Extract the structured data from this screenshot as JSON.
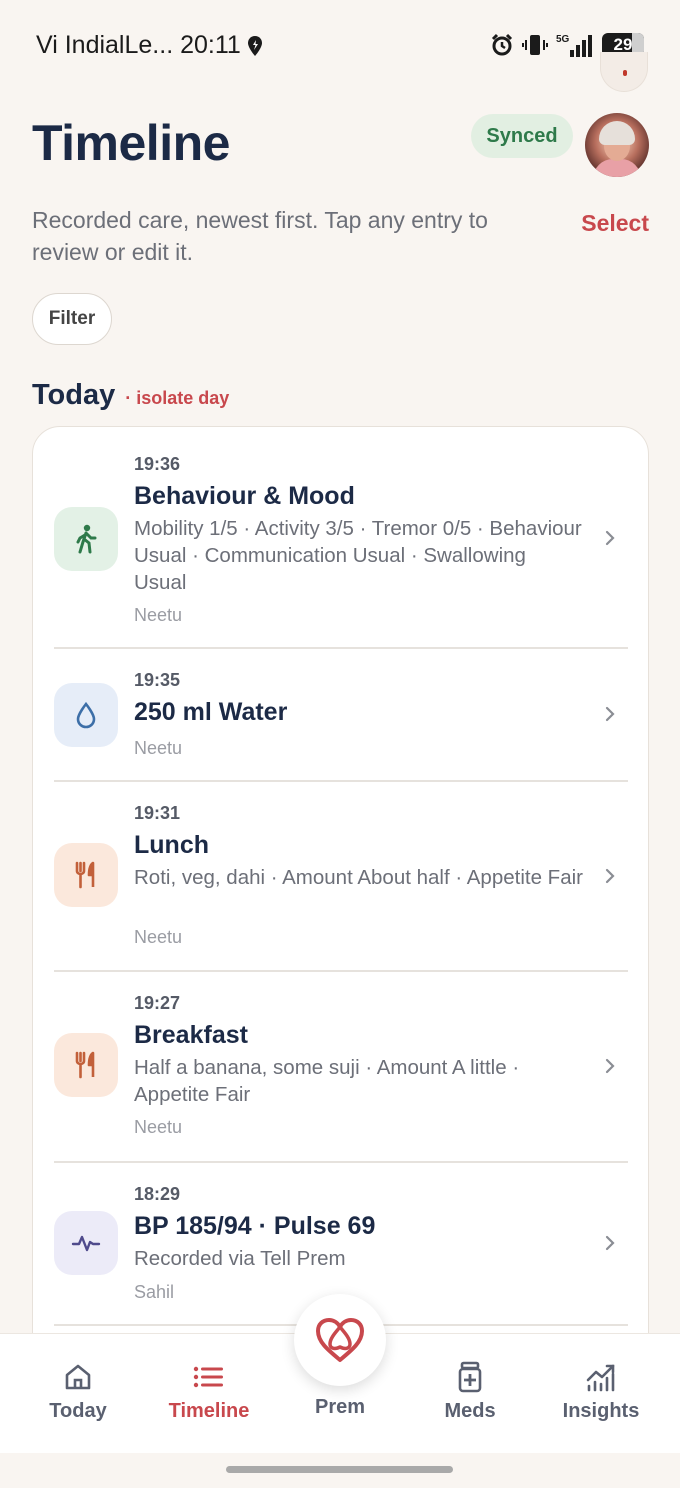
{
  "status_bar": {
    "carrier_time": "Vi IndialLe... 20:11",
    "battery": "29",
    "network": "5G"
  },
  "header": {
    "title": "Timeline",
    "sync_status": "Synced",
    "subtitle": "Recorded care, newest first. Tap any entry to review or edit it.",
    "select_label": "Select",
    "filter_label": "Filter"
  },
  "section": {
    "title": "Today",
    "isolate_label": "· isolate day"
  },
  "entries": [
    {
      "time": "19:36",
      "title": "Behaviour & Mood",
      "detail": "Mobility 1/5 · Activity 3/5 · Tremor 0/5 · Behaviour Usual · Communication Usual · Swallowing Usual",
      "author": "Neetu",
      "icon": "walking-person-icon",
      "icon_bg": "#e3f1e6",
      "icon_color": "#2e7a4a"
    },
    {
      "time": "19:35",
      "title": "250 ml Water",
      "detail": "",
      "author": "Neetu",
      "icon": "water-drop-icon",
      "icon_bg": "#e6edf8",
      "icon_color": "#3d6fa8"
    },
    {
      "time": "19:31",
      "title": "Lunch",
      "detail": "Roti, veg, dahi · Amount About half · Appetite Fair",
      "author": "Neetu",
      "icon": "fork-knife-icon",
      "icon_bg": "#fbe8dc",
      "icon_color": "#c2603a"
    },
    {
      "time": "19:27",
      "title": "Breakfast",
      "detail": "Half a banana, some suji · Amount A little · Appetite Fair",
      "author": "Neetu",
      "icon": "fork-knife-icon",
      "icon_bg": "#fbe8dc",
      "icon_color": "#c2603a"
    },
    {
      "time": "18:29",
      "title": "BP 185/94 · Pulse 69",
      "detail": "Recorded via Tell Prem",
      "author": "Sahil",
      "icon": "pulse-icon",
      "icon_bg": "#ecebf8",
      "icon_color": "#4f4a8c"
    }
  ],
  "nav": {
    "today": "Today",
    "timeline": "Timeline",
    "prem": "Prem",
    "meds": "Meds",
    "insights": "Insights",
    "active_color": "#c8484d"
  }
}
